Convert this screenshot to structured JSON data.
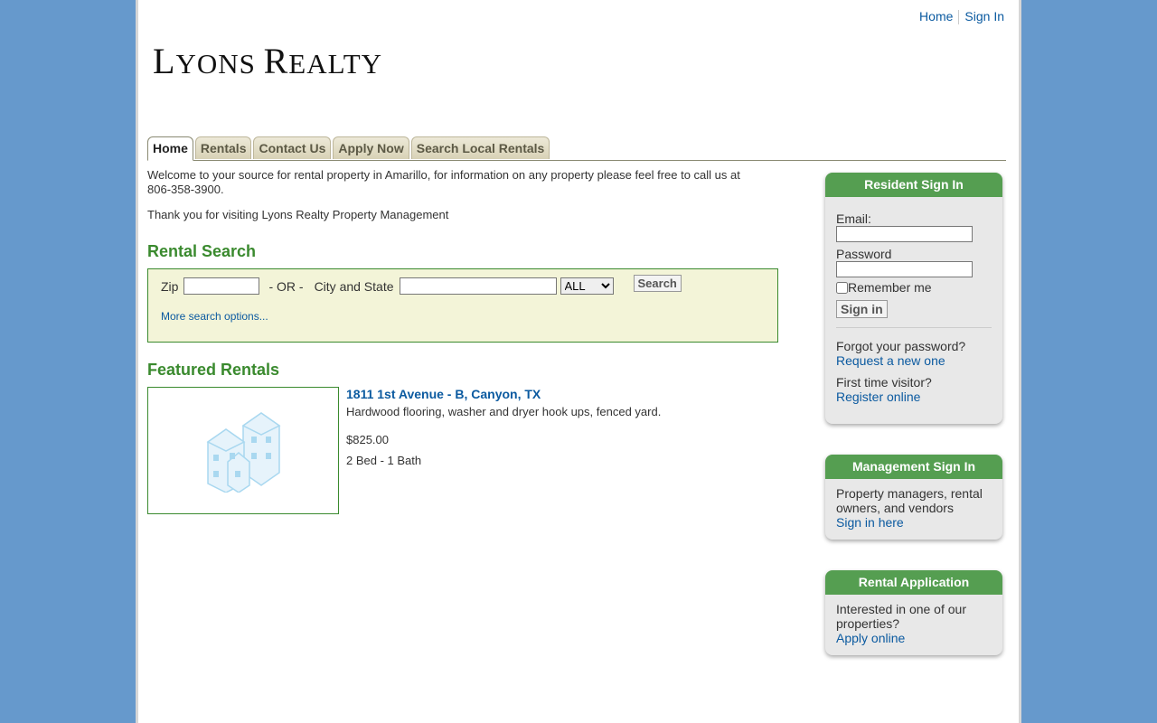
{
  "header": {
    "home_link": "Home",
    "signin_link": "Sign In",
    "logo_first_letter": "L",
    "logo_rest1": "YONS ",
    "logo_second_letter": "R",
    "logo_rest2": "EALTY"
  },
  "tabs": [
    {
      "label": "Home",
      "active": true
    },
    {
      "label": "Rentals"
    },
    {
      "label": "Contact Us"
    },
    {
      "label": "Apply Now"
    },
    {
      "label": "Search Local Rentals"
    }
  ],
  "main": {
    "welcome": "Welcome to your source for rental property in Amarillo, for information on any property please feel free to call us at 806-358-3900.",
    "thanks": "Thank you for visiting Lyons Realty Property Management",
    "search": {
      "heading": "Rental Search",
      "zip_label": "Zip",
      "or_label": "- OR -",
      "city_label": "City and State",
      "state_selected": "ALL",
      "search_button": "Search",
      "more_options": "More search options..."
    },
    "featured": {
      "heading": "Featured Rentals",
      "title": "1811 1st Avenue - B, Canyon, TX",
      "description": "Hardwood flooring, washer and dryer hook ups, fenced yard.",
      "price": "$825.00",
      "beds_baths": "2 Bed - 1 Bath",
      "image_icon": "house-placeholder-icon"
    }
  },
  "sidebar": {
    "resident": {
      "title": "Resident Sign In",
      "email_label": "Email:",
      "password_label": "Password",
      "remember_label": "Remember me",
      "signin_button": "Sign in",
      "forgot_text": "Forgot your password?",
      "forgot_link": "Request a new one",
      "first_time_text": "First time visitor?",
      "register_link": "Register online"
    },
    "management": {
      "title": "Management Sign In",
      "text": "Property managers, rental owners, and vendors",
      "link": "Sign in here"
    },
    "application": {
      "title": "Rental Application",
      "text": "Interested in one of our properties?",
      "link": "Apply online"
    }
  },
  "colors": {
    "background": "#6699cc",
    "accent_green": "#3a8a2e",
    "panel_header_green": "#559e51",
    "link_blue": "#0b5aa0",
    "search_bg": "#f3f4d8"
  }
}
